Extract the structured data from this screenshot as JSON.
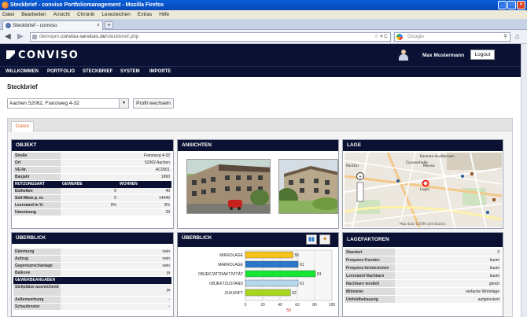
{
  "window": {
    "title": "Steckbrief - conviso Portfoliomanagement - Mozilla Firefox",
    "buttons": [
      "_",
      "□",
      "×"
    ]
  },
  "menu": [
    "Datei",
    "Bearbeiten",
    "Ansicht",
    "Chronik",
    "Lesezeichen",
    "Extras",
    "Hilfe"
  ],
  "browser": {
    "tab_title": "Steckbrief - conviso Portfoliomanagement",
    "tab_close": "×",
    "new_tab": "+",
    "url_host": "demopm.",
    "url_domain": "conviso-services.de",
    "url_path": "/steckbrief.php",
    "url_controls": "☆ ▾ C",
    "search_placeholder": "Google",
    "back": "◀",
    "forward": "▶",
    "home": "⌂",
    "magnifier": "⚲"
  },
  "app": {
    "logo": "CONVISO",
    "user_name": "Max Mustermann",
    "logout_label": "Logout",
    "nav": [
      "WILLKOMMEN",
      "PORTFOLIO",
      "STECKBRIEF",
      "SYSTEM",
      "IMPORTE"
    ]
  },
  "page": {
    "title": "Steckbrief",
    "address": "Aachen 52062, Franzweg 4-32",
    "dropdown_arrow": "▼",
    "profile_button": "Profil wechseln",
    "tab_label": "Daten"
  },
  "objekt": {
    "header": "OBJEKT",
    "rows": [
      {
        "k": "Straße",
        "v": "Franzweg 4-32"
      },
      {
        "k": "Ort",
        "v": "52062 Aachen"
      },
      {
        "k": "VE-Nr.",
        "v": "AC0001"
      },
      {
        "k": "Baujahr",
        "v": "1960"
      }
    ],
    "nutzung_header": [
      "NUTZUNGSART",
      "GEWERBE",
      "WOHNEN"
    ],
    "nutzung_rows": [
      {
        "k": "Einheiten",
        "g": "0",
        "w": "40"
      },
      {
        "k": "Soll-Miete p. m.",
        "g": "0",
        "w": "14040"
      },
      {
        "k": "Leerstand in %",
        "g": "0%",
        "w": "3%"
      },
      {
        "k": "Umsetzung",
        "g": "",
        "w": "33"
      }
    ]
  },
  "ansichten": {
    "header": "ANSICHTEN"
  },
  "lage": {
    "header": "LAGE",
    "map_labels": [
      "Karman-Auditorium",
      "Couvenhalle",
      "Mensa",
      "Logoi",
      "Ponttor"
    ],
    "attribution": "Map data ©OSM contributors"
  },
  "ueberblick_left": {
    "header": "ÜBERBLICK",
    "rows": [
      {
        "k": "Dämmung",
        "v": "nein"
      },
      {
        "k": "Aufzug",
        "v": "nein"
      },
      {
        "k": "Gegensprechanlage",
        "v": "nein"
      },
      {
        "k": "Balkone",
        "v": "ja"
      }
    ],
    "gewerbe_header": "GEWERBEANGABEN",
    "gewerbe_rows": [
      {
        "k": "Stellplätze ausreichend",
        "v": "ja"
      },
      {
        "k": "Außenwerbung",
        "v": "-"
      },
      {
        "k": "Schaufenster",
        "v": "-"
      }
    ]
  },
  "ueberblick_chart": {
    "header": "ÜBERBLICK",
    "btn1": "▮▮",
    "btn2": "✦",
    "marker_label": "50"
  },
  "chart_data": {
    "type": "bar",
    "orientation": "horizontal",
    "categories": [
      "MIKROLAGE",
      "MAKROLAGE",
      "OBJEKTATTRAKTIVITÄT",
      "OBJEKTZUSTAND",
      "ZUKUNFT"
    ],
    "values": [
      55,
      61,
      81,
      61,
      52
    ],
    "colors": [
      "#f7c31b",
      "#2a77c7",
      "#17e534",
      "#b5d7ee",
      "#a8d61e"
    ],
    "xlim": [
      0,
      100
    ],
    "xticks": [
      0,
      20,
      40,
      60,
      80,
      100
    ],
    "grid": true
  },
  "lagefaktoren": {
    "header": "LAGEFAKTOREN",
    "rows": [
      {
        "k": "Standort",
        "v": "2"
      },
      {
        "k": "Frequenz-Kunden",
        "v": "kaum"
      },
      {
        "k": "Frequenz-Immissionen",
        "v": "kaum"
      },
      {
        "k": "Leerstand Nachbarn",
        "v": "kaum"
      },
      {
        "k": "Nachbarn tendiell",
        "v": "gleich"
      },
      {
        "k": "Mitmieter",
        "v": "einfache Wohnlage"
      },
      {
        "k": "Umfeldbebauung",
        "v": "aufgelockert"
      }
    ]
  }
}
